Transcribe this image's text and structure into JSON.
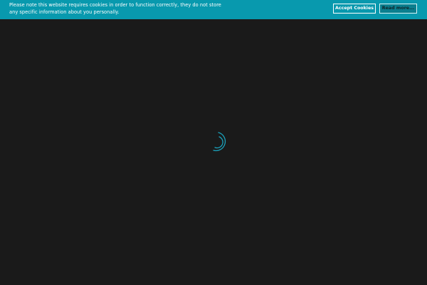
{
  "cookie_notice": {
    "message": "Please note this website requires cookies in order to function correctly, they do not store any specific information about you personally.",
    "accept_label": "Accept Cookies",
    "read_more_label": "Read more..."
  },
  "colors": {
    "banner_background": "#0899ae",
    "page_background": "#1a1a1a",
    "spinner": "#1aa3bd"
  },
  "icons": {
    "loader": "loading-spinner-icon"
  }
}
